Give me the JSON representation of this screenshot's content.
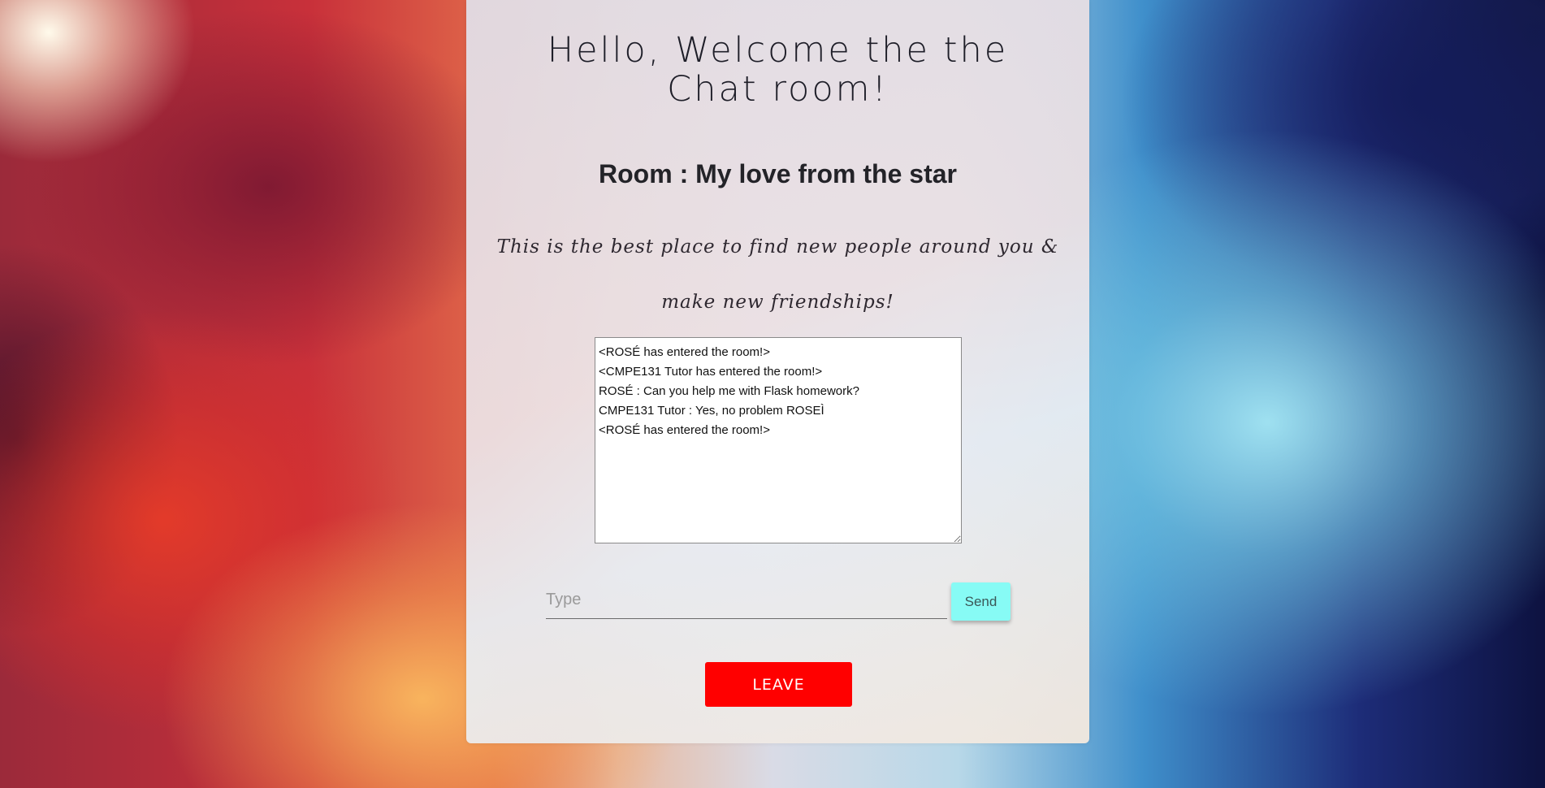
{
  "page": {
    "title": "Hello, Welcome the the Chat room!",
    "room_label": "Room : My love from the star",
    "tagline": "This is the best place to find new people around you & make new friendships!"
  },
  "chat": {
    "log_text": "<ROSÉ has entered the room!>\n<CMPE131 Tutor has entered the room!>\nROSÉ : Can you help me with Flask homework?\nCMPE131 Tutor : Yes, no problem ROSEÌ\n<ROSÉ has entered the room!>",
    "messages": [
      "<ROSÉ has entered the room!>",
      "<CMPE131 Tutor has entered the room!>",
      "ROSÉ : Can you help me with Flask homework?",
      "CMPE131 Tutor : Yes, no problem ROSEÌ",
      "<ROSÉ has entered the room!>"
    ]
  },
  "input": {
    "placeholder": "Type",
    "value": ""
  },
  "buttons": {
    "send_label": "Send",
    "leave_label": "LEAVE"
  },
  "colors": {
    "send_button": "#87fbf5",
    "leave_button": "#ff0000"
  }
}
